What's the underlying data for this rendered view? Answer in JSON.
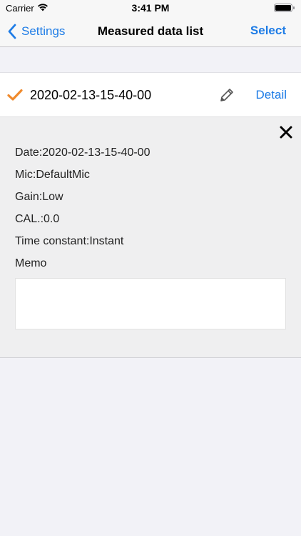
{
  "status": {
    "carrier": "Carrier",
    "time": "3:41 PM"
  },
  "nav": {
    "back_label": "Settings",
    "title": "Measured data list",
    "select_label": "Select"
  },
  "entry": {
    "title": "2020-02-13-15-40-00",
    "detail_label": "Detail"
  },
  "details": {
    "date": "Date:2020-02-13-15-40-00",
    "mic": "Mic:DefaultMic",
    "gain": "Gain:Low",
    "cal": "CAL.:0.0",
    "time_constant": "Time constant:Instant",
    "memo_label": "Memo",
    "memo_value": ""
  },
  "colors": {
    "accent": "#1e7ce6",
    "check": "#f08a2c",
    "panel": "#efeff0",
    "background": "#f2f2f7"
  },
  "icons": [
    "wifi-icon",
    "battery-icon",
    "chevron-left-icon",
    "checkmark-icon",
    "pencil-icon",
    "close-icon"
  ]
}
